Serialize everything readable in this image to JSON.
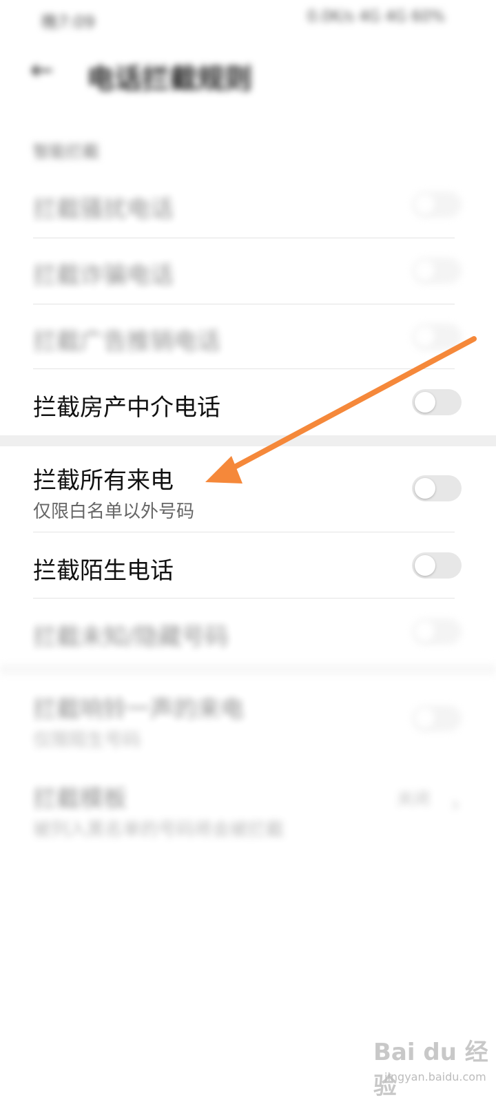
{
  "status_bar": {
    "left": "晚7:09",
    "right": "0.0K/s 4G 4G 60%"
  },
  "header": {
    "title": "电话拦截规则"
  },
  "section_label": "智能拦截",
  "rows": [
    {
      "title": "拦截骚扰电话",
      "enabled": false
    },
    {
      "title": "拦截诈骗电话",
      "enabled": false
    },
    {
      "title": "拦截广告推销电话",
      "enabled": false
    },
    {
      "title": "拦截房产中介电话",
      "enabled": false
    },
    {
      "title": "拦截所有来电",
      "subtitle": "仅限白名单以外号码",
      "enabled": false
    },
    {
      "title": "拦截陌生电话",
      "enabled": false
    },
    {
      "title": "拦截未知/隐藏号码",
      "enabled": false
    },
    {
      "title": "拦截响铃一声的来电",
      "subtitle": "仅限陌生号码",
      "enabled": false
    },
    {
      "title": "拦截模板",
      "subtitle": "被列入黑名单的号码将会被拦截",
      "value": "关闭"
    }
  ],
  "annotation": {
    "arrow_color": "#F5883A"
  },
  "watermark": {
    "brand": "Bai du 经验",
    "url": "jingyan.baidu.com"
  }
}
